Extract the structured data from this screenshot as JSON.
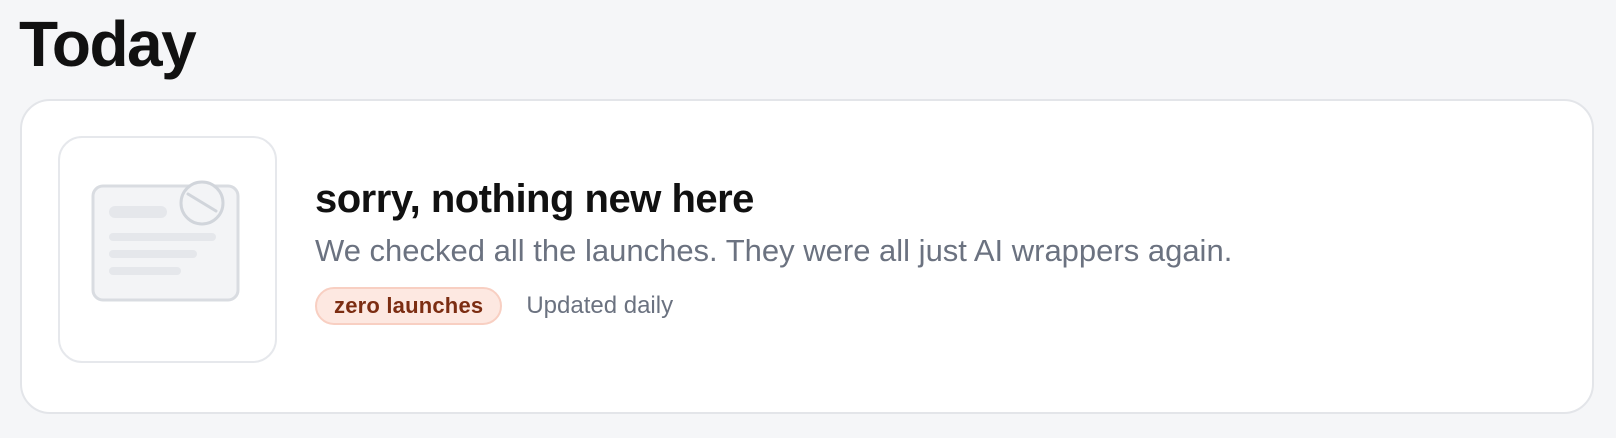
{
  "header": {
    "title": "Today"
  },
  "empty_state": {
    "title": "sorry, nothing new here",
    "description": "We checked all the launches. They were all just AI wrappers again.",
    "badge": "zero launches",
    "meta": "Updated daily",
    "thumbnail_icon": "empty-card-with-prohibited-badge-icon"
  },
  "colors": {
    "page_background": "#f5f6f8",
    "card_background": "#ffffff",
    "title_text": "#111111",
    "muted_text": "#6b7280",
    "badge_background": "#fde8e1",
    "badge_border": "#f8cfc2",
    "badge_text": "#7c2d12",
    "placeholder_gray": "#e5e7eb"
  }
}
